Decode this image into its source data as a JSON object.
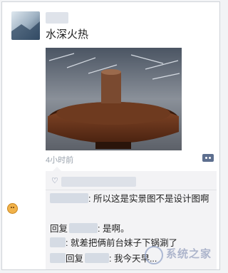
{
  "post": {
    "text": "水深火热",
    "time": "4小时前"
  },
  "comments": [
    {
      "suffix": ": 所以这是实景图不是设计图啊"
    },
    {
      "prefix": "回复",
      "suffix": ": 是啊。"
    },
    {
      "suffix": ": 就差把俩前台妹子下锅涮了"
    },
    {
      "prefix": "回复",
      "suffix": ": 我今天早..."
    }
  ],
  "watermark": {
    "text": "系统之家"
  },
  "colors": {
    "link_blue": "#5d6f8f",
    "comment_bg": "#f3f3f5",
    "time_gray": "#9aa3ad"
  }
}
